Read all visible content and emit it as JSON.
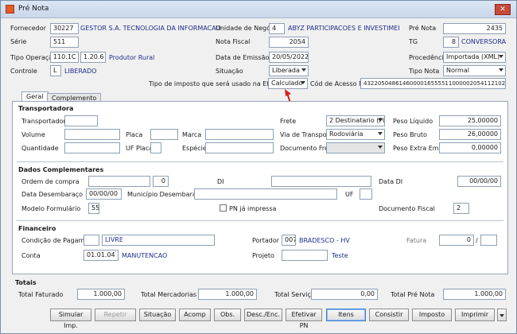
{
  "window": {
    "title": "Pré Nota",
    "close": "✕"
  },
  "header": {
    "fornecedor": {
      "label": "Fornecedor",
      "code": "30227",
      "name": "GESTOR S.A. TECNOLOGIA DA INFORMACAO"
    },
    "serie": {
      "label": "Série",
      "value": "511"
    },
    "tipo_operacao": {
      "label": "Tipo Operação",
      "code1": "110.1C",
      "code2": "1.20.6",
      "desc": "Produtor Rural"
    },
    "controle": {
      "label": "Controle",
      "value": "L",
      "desc": "LIBERADO"
    },
    "unidade": {
      "label": "Unidade de Negócio",
      "code": "4",
      "name": "ABYZ PARTICIPACOES E INVESTIMENTOS L"
    },
    "nota_fiscal": {
      "label": "Nota Fiscal",
      "value": "2054"
    },
    "data_emissao": {
      "label": "Data de Emissão",
      "value": "20/05/2022"
    },
    "situacao": {
      "label": "Situação",
      "value": "Liberada"
    },
    "pre_nota": {
      "label": "Pré Nota",
      "value": "2435"
    },
    "tg": {
      "label": "TG",
      "code": "8",
      "name": "CONVERSORA"
    },
    "procedencia": {
      "label": "Procedência",
      "value": "Importada (XML)"
    },
    "tipo_nota": {
      "label": "Tipo Nota",
      "value": "Normal"
    },
    "tipo_imposto": {
      "label": "Tipo de imposto que será usado na Efetivação",
      "value": "Calculado"
    },
    "cod_acesso": {
      "label": "Cód de Acesso NFe",
      "value": "43220504861460000165555110000020541121029429"
    }
  },
  "tabs": [
    {
      "label": "Geral"
    },
    {
      "label": "Complemento"
    }
  ],
  "transportadora": {
    "title": "Transportadora",
    "transportadora_label": "Transportadora",
    "volume_label": "Volume",
    "placa_label": "Placa",
    "marca_label": "Marca",
    "quantidade_label": "Quantidade",
    "uf_placa_label": "UF Placa",
    "especie_label": "Espécie",
    "frete_label": "Frete",
    "frete_value": "2 Destinatario (FC",
    "via_label": "Via de Transporte",
    "via_value": "Rodoviária",
    "doc_frete_label": "Documento Frete",
    "peso_liquido_label": "Peso Líquido",
    "peso_liquido": "25,00000",
    "peso_bruto_label": "Peso Bruto",
    "peso_bruto": "26,00000",
    "peso_extra_label": "Peso Extra Emb.",
    "peso_extra": "0,00000"
  },
  "complementares": {
    "title": "Dados Complementares",
    "ordem_label": "Ordem de compra",
    "ordem_seq": "0",
    "di_label": "DI",
    "data_di_label": "Data DI",
    "data_di": "00/00/00",
    "data_desemb_label": "Data Desembaraço",
    "data_desemb": "00/00/00",
    "municipio_label": "Município Desembaraço",
    "uf_label": "UF",
    "modelo_label": "Modelo Formulário",
    "modelo": "55",
    "pn_impressa_label": "PN já impressa",
    "doc_fiscal_label": "Documento Fiscal",
    "doc_fiscal": "2"
  },
  "financeiro": {
    "title": "Financeiro",
    "cond_label": "Condição de Pagamento",
    "cond_value": "LIVRE",
    "conta_label": "Conta",
    "conta_code": "01.01.04",
    "conta_name": "MANUTENCAO",
    "portador_label": "Portador",
    "portador_code": "007",
    "portador_name": "BRADESCO - HV",
    "projeto_label": "Projeto",
    "projeto_name": "Teste",
    "fatura_label": "Fatura",
    "fatura_value": "0",
    "fatura_sep": "/"
  },
  "totais": {
    "title": "Totais",
    "faturado_label": "Total Faturado",
    "faturado": "1.000,00",
    "mercadorias_label": "Total Mercadorias",
    "mercadorias": "1.000,00",
    "servico_label": "Total Serviço",
    "servico": "0,00",
    "pre_nota_label": "Total Pré Nota",
    "pre_nota": "1.000,00"
  },
  "buttons": [
    "Simular Imp.",
    "Repetir",
    "Situação",
    "Acomp",
    "Obs.",
    "Desc./Enc.",
    "Efetivar PN",
    "Itens",
    "Consistir",
    "Imposto",
    "Imprimir"
  ],
  "colors": {
    "arrow": "#d42020",
    "label_blue": "#1e2f8c"
  }
}
